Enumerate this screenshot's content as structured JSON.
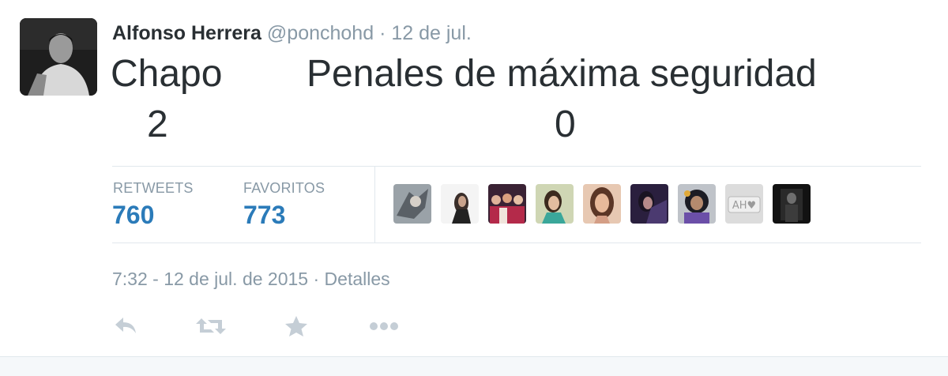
{
  "tweet": {
    "author": {
      "full_name": "Alfonso Herrera",
      "username": "@ponchohd",
      "separator": "·",
      "timestamp_short": "12 de jul."
    },
    "text": {
      "line1_left": "Chapo",
      "line1_right": "Penales de máxima seguridad",
      "line2_left": "2",
      "line2_right": "0"
    },
    "stats": {
      "retweets_label": "RETWEETS",
      "retweets_count": "760",
      "favorites_label": "FAVORITOS",
      "favorites_count": "773"
    },
    "favoriters": [
      {
        "name": "favoriter-avatar-1"
      },
      {
        "name": "favoriter-avatar-2"
      },
      {
        "name": "favoriter-avatar-3"
      },
      {
        "name": "favoriter-avatar-4"
      },
      {
        "name": "favoriter-avatar-5"
      },
      {
        "name": "favoriter-avatar-6"
      },
      {
        "name": "favoriter-avatar-7"
      },
      {
        "name": "favoriter-avatar-8"
      },
      {
        "name": "favoriter-avatar-9"
      }
    ],
    "meta": {
      "datetime": "7:32 - 12 de jul. de 2015",
      "separator": "·",
      "details_link": "Detalles"
    },
    "actions": [
      "reply-icon",
      "retweet-icon",
      "favorite-icon",
      "more-icon"
    ]
  },
  "colors": {
    "link_blue": "#2b7bb9",
    "text_dark": "#292f33",
    "text_gray": "#8899a6",
    "icon_gray": "#c5ced6",
    "border": "#e1e8ed"
  }
}
